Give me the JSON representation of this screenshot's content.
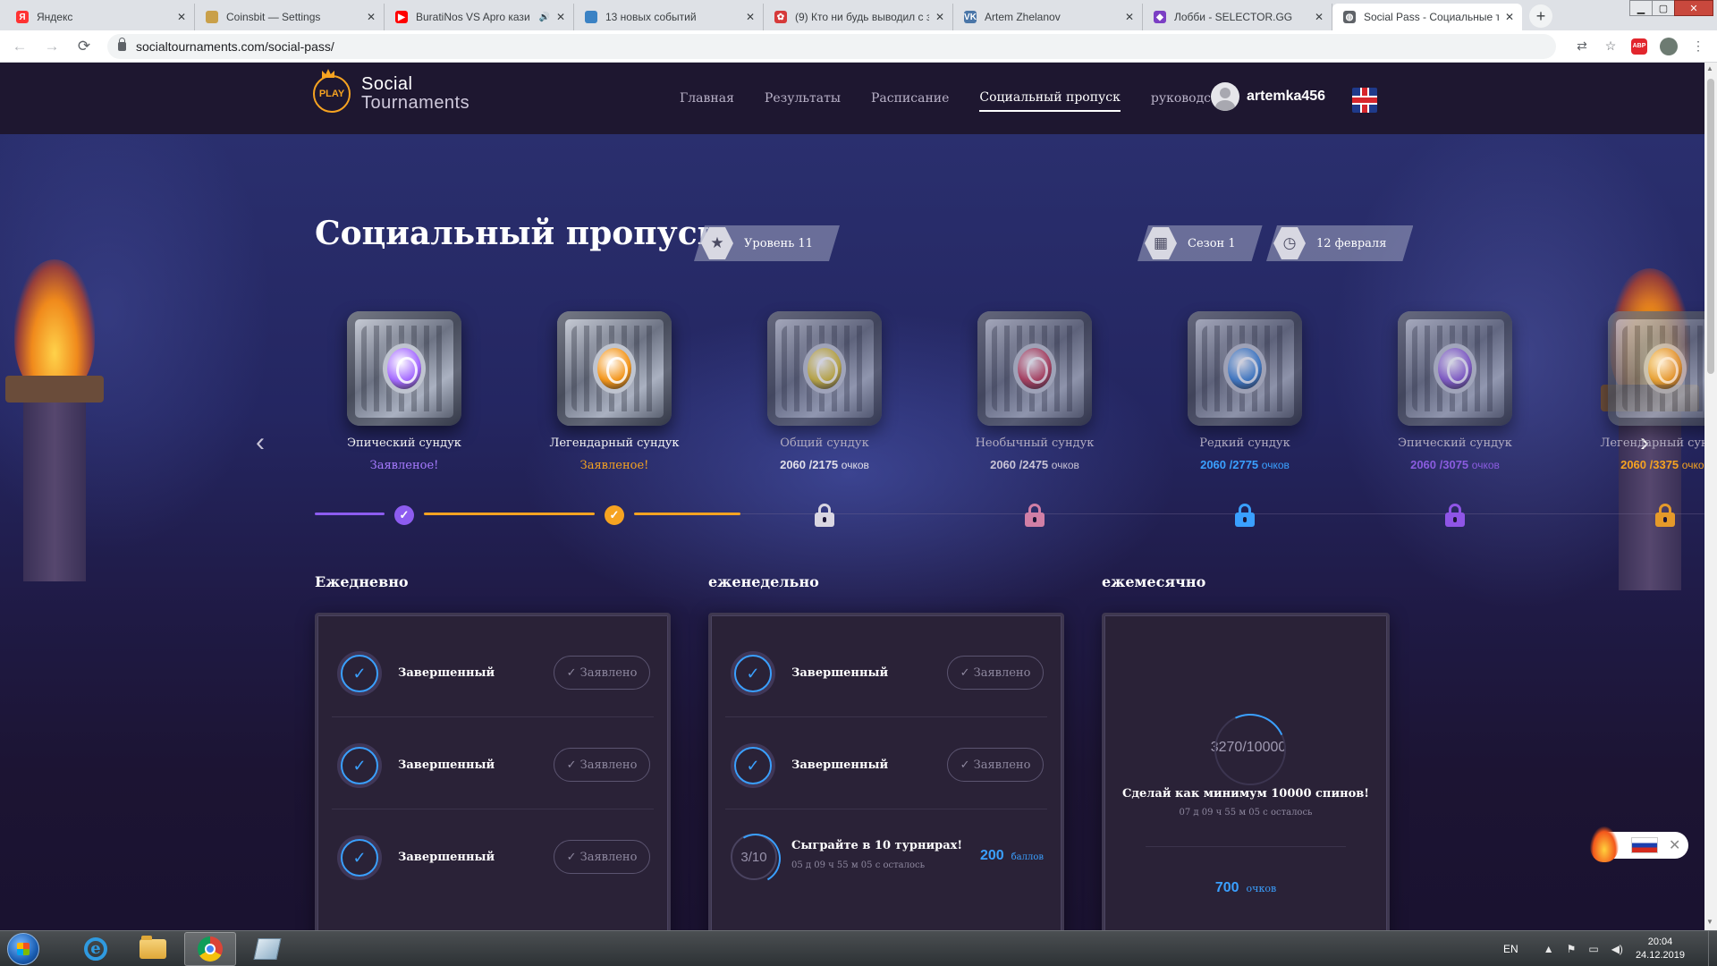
{
  "browser": {
    "tabs": [
      {
        "title": "Яндекс",
        "favicon": "yandex-icon",
        "color": "#ff3333",
        "glyph": "Я"
      },
      {
        "title": "Coinsbit — Settings",
        "favicon": "coinsbit-icon",
        "color": "#c9a04a",
        "glyph": ""
      },
      {
        "title": "BuratiNos VS Apro кази",
        "favicon": "youtube-icon",
        "color": "#ff0000",
        "glyph": "▶",
        "audio": "🔊"
      },
      {
        "title": "13 новых событий",
        "favicon": "globe-icon",
        "color": "#3b82c4",
        "glyph": ""
      },
      {
        "title": "(9) Кто ни будь выводил с з",
        "favicon": "settings-icon",
        "color": "#d63a3a",
        "glyph": "✿"
      },
      {
        "title": "Artem Zhelanov",
        "favicon": "vk-icon",
        "color": "#4a76a8",
        "glyph": "VK"
      },
      {
        "title": "Лобби - SELECTOR.GG",
        "favicon": "selector-icon",
        "color": "#7b3fc4",
        "glyph": "◆"
      },
      {
        "title": "Social Pass - Социальные т",
        "favicon": "globe-icon",
        "color": "#5f6368",
        "glyph": "◍",
        "active": true
      }
    ],
    "new_tab": "+",
    "url": "socialtournaments.com/social-pass/"
  },
  "site": {
    "logo_badge": "PLAY",
    "logo_line1": "Social",
    "logo_line2": "Tournaments",
    "nav": [
      "Главная",
      "Результаты",
      "Расписание",
      "Социальный пропуск",
      "руководства"
    ],
    "active_nav": 3,
    "username": "artemka456"
  },
  "hero": {
    "title": "Социальный пропуск",
    "level_label": "Уровень 11",
    "season_label": "Сезон 1",
    "end_date_label": "12 февраля"
  },
  "chests": [
    {
      "name": "Эпический сундук",
      "status": "Заявленое!",
      "status_color": "#a77bff",
      "gem_color": "#a56bff",
      "locked": false
    },
    {
      "name": "Легендарный сундук",
      "status": "Заявленое!",
      "status_color": "#f6a321",
      "gem_color": "#f3961c",
      "locked": false
    },
    {
      "name": "Общий сундук",
      "points": "2060 /2175",
      "unit": "очков",
      "points_color": "#e2e0ea",
      "gem_color": "#e2c21a",
      "locked": true,
      "lock_color": "#d9d6e2"
    },
    {
      "name": "Необычный сундук",
      "points": "2060 /2475",
      "unit": "очков",
      "points_color": "#c9c4d6",
      "gem_color": "#e0405e",
      "locked": true,
      "lock_color": "#d17fa6"
    },
    {
      "name": "Редкий сундук",
      "points": "2060 /2775",
      "unit": "очков",
      "points_color": "#3aa0ff",
      "gem_color": "#3a8ff0",
      "locked": true,
      "lock_color": "#3aa0ff"
    },
    {
      "name": "Эпический сундук",
      "points": "2060 /3075",
      "unit": "очков",
      "points_color": "#8a5cdf",
      "gem_color": "#9a60ef",
      "locked": true,
      "lock_color": "#8f55e6"
    },
    {
      "name": "Легендарный сундук",
      "points": "2060 /3375",
      "unit": "очков",
      "points_color": "#f6a321",
      "gem_color": "#f39a1c",
      "locked": true,
      "lock_color": "#e59a2a"
    }
  ],
  "colors": {
    "accent_blue": "#3aa0ff",
    "epic_purple": "#8d5cf0",
    "legendary_orange": "#f6a321"
  },
  "sections": {
    "daily": {
      "title": "Ежедневно",
      "tasks": [
        {
          "label": "Завершенный",
          "button": "✓ Заявлено"
        },
        {
          "label": "Завершенный",
          "button": "✓ Заявлено"
        },
        {
          "label": "Завершенный",
          "button": "✓ Заявлено"
        }
      ]
    },
    "weekly": {
      "title": "еженедельно",
      "tasks": [
        {
          "label": "Завершенный",
          "button": "✓ Заявлено"
        },
        {
          "label": "Завершенный",
          "button": "✓ Заявлено"
        }
      ],
      "progress_task": {
        "progress": "3/10",
        "description": "Сыграйте в 10 турнирах!",
        "time_left": "05 д 09 ч 55 м 05 с осталось",
        "reward": "200",
        "reward_unit": "баллов"
      }
    },
    "monthly": {
      "title": "ежемесячно",
      "progress": "3270/10000",
      "description": "Сделай как минимум 10000 спинов!",
      "time_left": "07 д 09 ч 55 м 05 с осталось",
      "reward": "700",
      "reward_unit": "очков"
    }
  },
  "taskbar": {
    "lang": "EN",
    "time": "20:04",
    "date": "24.12.2019"
  }
}
